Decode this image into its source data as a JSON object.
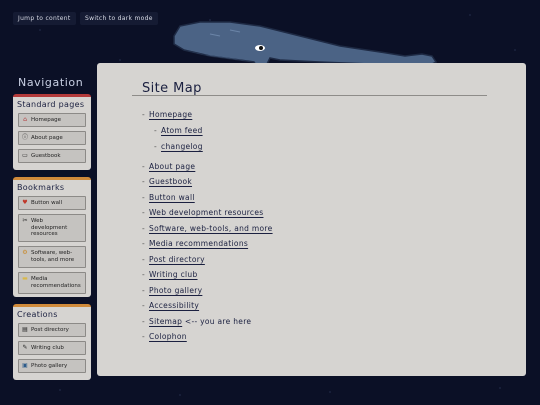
{
  "top_buttons": {
    "skip": "Jump to content",
    "dark": "Switch to dark mode"
  },
  "nav": {
    "title": "Navigation",
    "standard": {
      "heading": "Standard pages",
      "items": [
        {
          "label": "Homepage",
          "icon": "house-icon"
        },
        {
          "label": "About page",
          "icon": "info-icon"
        },
        {
          "label": "Guestbook",
          "icon": "book-icon"
        }
      ]
    },
    "bookmarks": {
      "heading": "Bookmarks",
      "items": [
        {
          "label": "Button wall",
          "icon": "heart-icon"
        },
        {
          "label": "Web development resources",
          "icon": "tools-icon"
        },
        {
          "label": "Software, web-tools, and more",
          "icon": "gear-icon"
        },
        {
          "label": "Media recommendations",
          "icon": "folder-icon"
        }
      ]
    },
    "creations": {
      "heading": "Creations",
      "items": [
        {
          "label": "Post directory",
          "icon": "notebook-icon"
        },
        {
          "label": "Writing club",
          "icon": "pencil-icon"
        },
        {
          "label": "Photo gallery",
          "icon": "photo-icon"
        }
      ]
    }
  },
  "main": {
    "title": "Site Map",
    "bullet": "-",
    "entries": [
      {
        "label": "Homepage"
      },
      {
        "label": "Atom feed"
      },
      {
        "label": "changelog"
      },
      {
        "label": "About page"
      },
      {
        "label": "Guestbook"
      },
      {
        "label": "Button wall"
      },
      {
        "label": "Web development resources"
      },
      {
        "label": "Software, web-tools, and more"
      },
      {
        "label": "Media recommendations"
      },
      {
        "label": "Post directory"
      },
      {
        "label": "Writing club"
      },
      {
        "label": "Photo gallery"
      },
      {
        "label": "Accessibility"
      },
      {
        "label": "Sitemap",
        "note": "<-- you are here"
      },
      {
        "label": "Colophon"
      }
    ]
  },
  "colors": {
    "background": "#0b1026",
    "panel": "#d6d4d1",
    "whale": "#4b6385",
    "accent_red": "#b33a3a",
    "accent_orange": "#d08a3a"
  }
}
